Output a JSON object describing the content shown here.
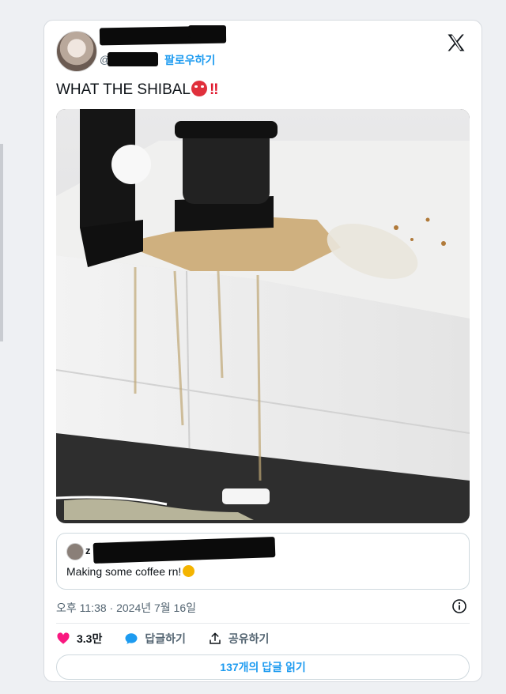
{
  "tweet": {
    "handle_prefix": "@",
    "follow_label": "팔로우하기",
    "text": "WHAT THE SHIBAL",
    "emphasis": "‼",
    "quote": {
      "initial": "z",
      "text": "Making some coffee rn!"
    },
    "timestamp": "오후 11:38 · 2024년 7월 16일",
    "actions": {
      "likes": "3.3만",
      "reply_label": "답글하기",
      "share_label": "공유하기"
    },
    "read_replies_label": "137개의 답글 읽기"
  },
  "colors": {
    "accent": "#1d9bf0",
    "like": "#f91880",
    "text": "#0f1419",
    "muted": "#536471"
  },
  "icons": [
    "x-logo-icon",
    "angry-face-emoji-icon",
    "double-exclamation-icon",
    "heart-icon",
    "reply-bubble-icon",
    "share-icon",
    "info-icon",
    "smile-emoji-icon"
  ]
}
